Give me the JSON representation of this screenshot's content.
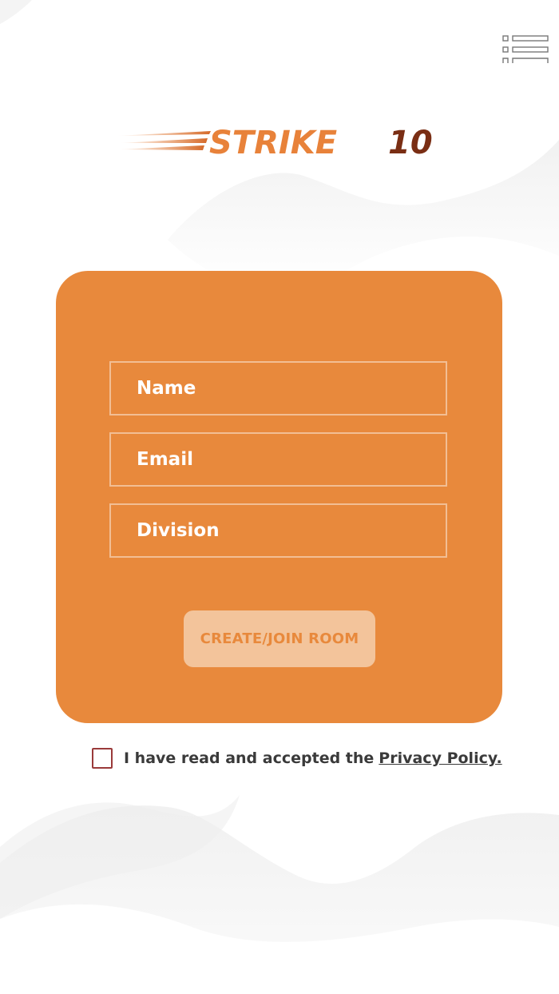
{
  "brand": {
    "logo_word": "STRIKE",
    "logo_number": "10"
  },
  "colors": {
    "card_background": "#E8893C",
    "button_background": "#F3C49B",
    "button_text": "#E8893C",
    "logo_orange": "#E8823A",
    "logo_dark": "#7A2E14",
    "text_dark": "#3A3A3A",
    "checkbox_border": "#9A3A3A"
  },
  "header": {
    "menu_icon": "list-menu-icon"
  },
  "form": {
    "name_placeholder": "Name",
    "email_placeholder": "Email",
    "division_placeholder": "Division",
    "submit_label": "CREATE/JOIN ROOM"
  },
  "consent": {
    "text": "I have read and accepted the",
    "link_label": "Privacy Policy.",
    "checked": false
  }
}
